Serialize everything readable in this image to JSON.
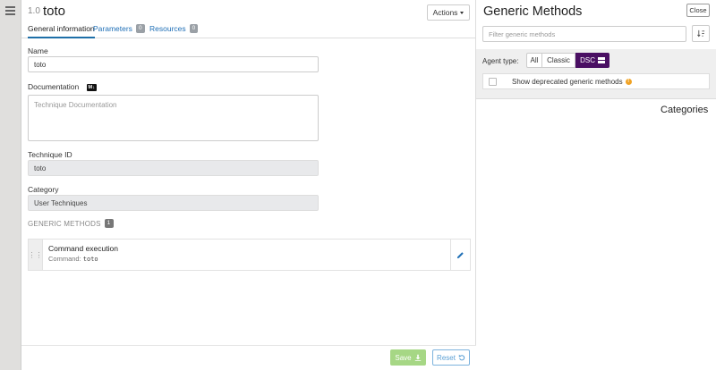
{
  "technique": {
    "version": "1.0",
    "name": "toto"
  },
  "header": {
    "actions_label": "Actions"
  },
  "tabs": [
    {
      "label": "General information"
    },
    {
      "label": "Parameters",
      "count": "0"
    },
    {
      "label": "Resources",
      "count": "0"
    }
  ],
  "form": {
    "name_label": "Name",
    "name_value": "toto",
    "documentation_label": "Documentation",
    "markdown_badge": "M↓",
    "documentation_placeholder": "Technique Documentation",
    "technique_id_label": "Technique ID",
    "technique_id_value": "toto",
    "category_label": "Category",
    "category_value": "User Techniques"
  },
  "generic_methods_section": {
    "title": "GENERIC METHODS",
    "count": "1",
    "items": [
      {
        "name": "Command execution",
        "detail_label": "Command:",
        "detail_value": "toto"
      }
    ]
  },
  "footer": {
    "save_label": "Save",
    "reset_label": "Reset",
    "save_color": "#a6d785"
  },
  "panel": {
    "title": "Generic Methods",
    "close_label": "Close",
    "filter_placeholder": "Filter generic methods",
    "agent_type_label": "Agent type:",
    "agent_types": [
      "All",
      "Classic",
      "DSC"
    ],
    "selected_agent_type": "DSC",
    "dsc_color": "#4a0f63",
    "deprecated_label": "Show deprecated generic methods",
    "categories_title": "Categories"
  },
  "icons": {
    "menu": "hamburger-icon",
    "actions": "caret-down-icon",
    "markdown": "markdown-icon",
    "drag": "drag-handle-icon",
    "edit": "pencil-icon",
    "save": "download-icon",
    "reset": "undo-icon",
    "sort": "sort-icon",
    "dsc": "windows-icon",
    "info": "info-icon"
  }
}
